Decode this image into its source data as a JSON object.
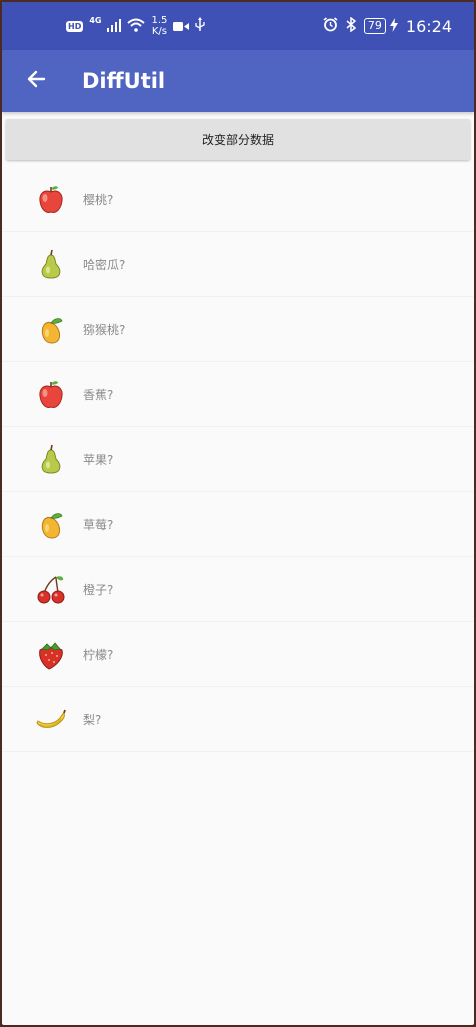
{
  "status_bar": {
    "hd_badge": "HD",
    "network_type": "4G",
    "speed_value": "1.5",
    "speed_unit": "K/s",
    "battery": "79",
    "time": "16:24",
    "icons": [
      "hd-icon",
      "signal-icon",
      "wifi-icon",
      "video-camera-icon",
      "usb-icon",
      "alarm-icon",
      "bluetooth-icon",
      "battery-icon",
      "charging-icon"
    ]
  },
  "app_bar": {
    "title": "DiffUtil",
    "back_icon": "arrow-left-icon",
    "background": "#5065c1"
  },
  "action_button": {
    "label": "改变部分数据"
  },
  "fruits": [
    {
      "label": "樱桃?",
      "icon": "apple-icon"
    },
    {
      "label": "哈密瓜?",
      "icon": "pear-icon"
    },
    {
      "label": "猕猴桃?",
      "icon": "mango-icon"
    },
    {
      "label": "香蕉?",
      "icon": "apple-icon"
    },
    {
      "label": "苹果?",
      "icon": "pear-icon"
    },
    {
      "label": "草莓?",
      "icon": "mango-icon"
    },
    {
      "label": "橙子?",
      "icon": "cherry-icon"
    },
    {
      "label": "柠檬?",
      "icon": "strawberry-icon"
    },
    {
      "label": "梨?",
      "icon": "banana-icon"
    }
  ],
  "colors": {
    "status_bar": "#3f51b5",
    "app_bar": "#5065c1",
    "button": "#e2e1e2",
    "label_text": "#8a8a8a"
  }
}
